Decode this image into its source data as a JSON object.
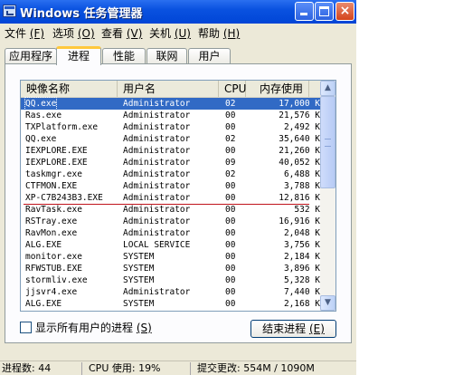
{
  "window": {
    "title": "Windows 任务管理器",
    "buttons": {
      "minimize": "minimize",
      "maximize": "maximize",
      "close": "×"
    }
  },
  "menu": [
    {
      "label": "文件",
      "key": "(F)"
    },
    {
      "label": "选项",
      "key": "(O)"
    },
    {
      "label": "查看",
      "key": "(V)"
    },
    {
      "label": "关机",
      "key": "(U)"
    },
    {
      "label": "帮助",
      "key": "(H)"
    }
  ],
  "tabs": [
    "应用程序",
    "进程",
    "性能",
    "联网",
    "用户"
  ],
  "active_tab": "进程",
  "columns": {
    "name": "映像名称",
    "user": "用户名",
    "cpu": "CPU",
    "mem": "内存使用"
  },
  "processes": [
    {
      "name": "QQ.exe",
      "user": "Administrator",
      "cpu": "02",
      "mem": "17,000 K"
    },
    {
      "name": "Ras.exe",
      "user": "Administrator",
      "cpu": "00",
      "mem": "21,576 K"
    },
    {
      "name": "TXPlatform.exe",
      "user": "Administrator",
      "cpu": "00",
      "mem": "2,492 K"
    },
    {
      "name": "QQ.exe",
      "user": "Administrator",
      "cpu": "02",
      "mem": "35,640 K"
    },
    {
      "name": "IEXPLORE.EXE",
      "user": "Administrator",
      "cpu": "00",
      "mem": "21,260 K"
    },
    {
      "name": "IEXPLORE.EXE",
      "user": "Administrator",
      "cpu": "09",
      "mem": "40,052 K"
    },
    {
      "name": "taskmgr.exe",
      "user": "Administrator",
      "cpu": "02",
      "mem": "6,488 K"
    },
    {
      "name": "CTFMON.EXE",
      "user": "Administrator",
      "cpu": "00",
      "mem": "3,788 K"
    },
    {
      "name": "XP-C7B243B3.EXE",
      "user": "Administrator",
      "cpu": "00",
      "mem": "12,816 K"
    },
    {
      "name": "RavTask.exe",
      "user": "Administrator",
      "cpu": "00",
      "mem": "532 K"
    },
    {
      "name": "RSTray.exe",
      "user": "Administrator",
      "cpu": "00",
      "mem": "16,916 K"
    },
    {
      "name": "RavMon.exe",
      "user": "Administrator",
      "cpu": "00",
      "mem": "2,048 K"
    },
    {
      "name": "ALG.EXE",
      "user": "LOCAL SERVICE",
      "cpu": "00",
      "mem": "3,756 K"
    },
    {
      "name": "monitor.exe",
      "user": "SYSTEM",
      "cpu": "00",
      "mem": "2,184 K"
    },
    {
      "name": "RFWSTUB.EXE",
      "user": "SYSTEM",
      "cpu": "00",
      "mem": "3,896 K"
    },
    {
      "name": "stormliv.exe",
      "user": "SYSTEM",
      "cpu": "00",
      "mem": "5,328 K"
    },
    {
      "name": "jjsvr4.exe",
      "user": "Administrator",
      "cpu": "00",
      "mem": "7,440 K"
    },
    {
      "name": "ALG.EXE",
      "user": "SYSTEM",
      "cpu": "00",
      "mem": "2,168 K"
    }
  ],
  "selected_index": 0,
  "checkbox": {
    "label": "显示所有用户的进程",
    "key": "(S)",
    "checked": false
  },
  "end_button": {
    "label": "结束进程",
    "key": "(E)"
  },
  "status": {
    "processes": "进程数: 44",
    "cpu": "CPU 使用: 19%",
    "commit": "提交更改: 554M / 1090M"
  },
  "colors": {
    "selection": "#316ac5",
    "separator": "#c0141c",
    "titlebar": "#0a52e0"
  }
}
